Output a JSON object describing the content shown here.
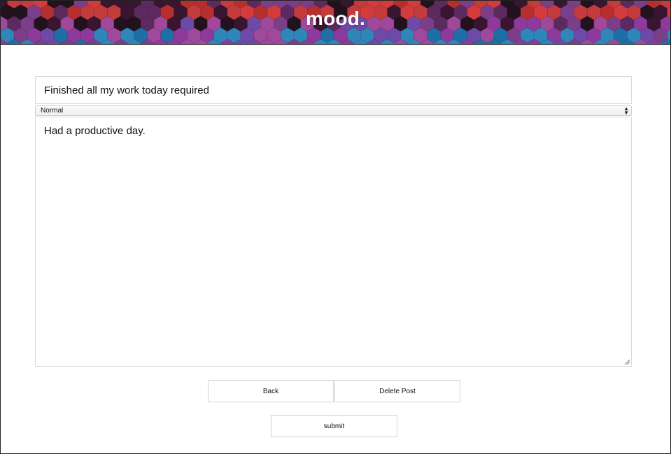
{
  "header": {
    "brand": "mood.",
    "mosaic_colors": [
      "#7b3f8a",
      "#8e3a9c",
      "#2f86b8",
      "#c33b3b",
      "#3a1530",
      "#5d2a5f",
      "#a0489a",
      "#1e6fa6",
      "#b52f2f",
      "#21121e",
      "#6e4aa8",
      "#d23c3c"
    ]
  },
  "form": {
    "title_value": "Finished all my work today required",
    "mood_selected": "Normal",
    "body_value": "Had a productive day."
  },
  "buttons": {
    "back_label": "Back",
    "delete_label": "Delete Post",
    "submit_label": "submit"
  }
}
